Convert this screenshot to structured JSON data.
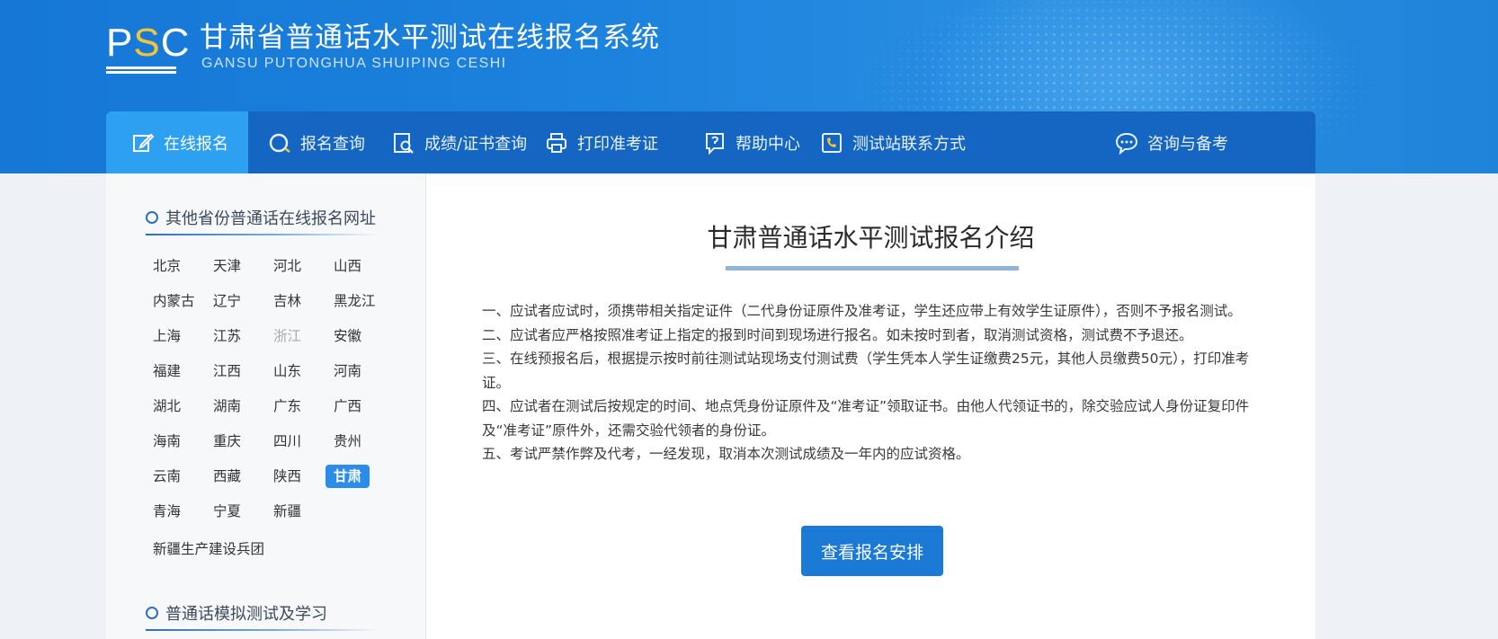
{
  "header": {
    "logo_text": "PSC",
    "title": "甘肃省普通话水平测试在线报名系统",
    "subtitle": "GANSU PUTONGHUA SHUIPING CESHI"
  },
  "nav": {
    "items": [
      {
        "label": "在线报名",
        "icon": "edit-icon",
        "active": true
      },
      {
        "label": "报名查询",
        "icon": "search-icon"
      },
      {
        "label": "成绩/证书查询",
        "icon": "document-search-icon"
      },
      {
        "label": "打印准考证",
        "icon": "printer-icon"
      },
      {
        "label": "帮助中心",
        "icon": "help-icon"
      },
      {
        "label": "测试站联系方式",
        "icon": "phone-icon"
      },
      {
        "label": "咨询与备考",
        "icon": "chat-icon"
      }
    ]
  },
  "sidebar": {
    "section1_title": "其他省份普通话在线报名网址",
    "provinces": [
      "北京",
      "天津",
      "河北",
      "山西",
      "内蒙古",
      "辽宁",
      "吉林",
      "黑龙江",
      "上海",
      "江苏",
      "浙江",
      "安徽",
      "福建",
      "江西",
      "山东",
      "河南",
      "湖北",
      "湖南",
      "广东",
      "广西",
      "海南",
      "重庆",
      "四川",
      "贵州",
      "云南",
      "西藏",
      "陕西",
      "甘肃",
      "青海",
      "宁夏",
      "新疆"
    ],
    "active_province": "甘肃",
    "dim_province": "浙江",
    "extra_item": "新疆生产建设兵团",
    "section2_title": "普通话模拟测试及学习"
  },
  "main": {
    "title": "甘肃普通话水平测试报名介绍",
    "paragraphs": [
      "一、应试者应试时，须携带相关指定证件（二代身份证原件及准考证，学生还应带上有效学生证原件），否则不予报名测试。",
      "二、应试者应严格按照准考证上指定的报到时间到现场进行报名。如未按时到者，取消测试资格，测试费不予退还。",
      "三、在线预报名后，根据提示按时前往测试站现场支付测试费（学生凭本人学生证缴费25元，其他人员缴费50元），打印准考证。",
      "四、应试者在测试后按规定的时间、地点凭身份证原件及“准考证”领取证书。由他人代领证书的，除交验应试人身份证复印件及“准考证”原件外，还需交验代领者的身份证。",
      "五、考试严禁作弊及代考，一经发现，取消本次测试成绩及一年内的应试资格。"
    ],
    "button_label": "查看报名安排"
  }
}
